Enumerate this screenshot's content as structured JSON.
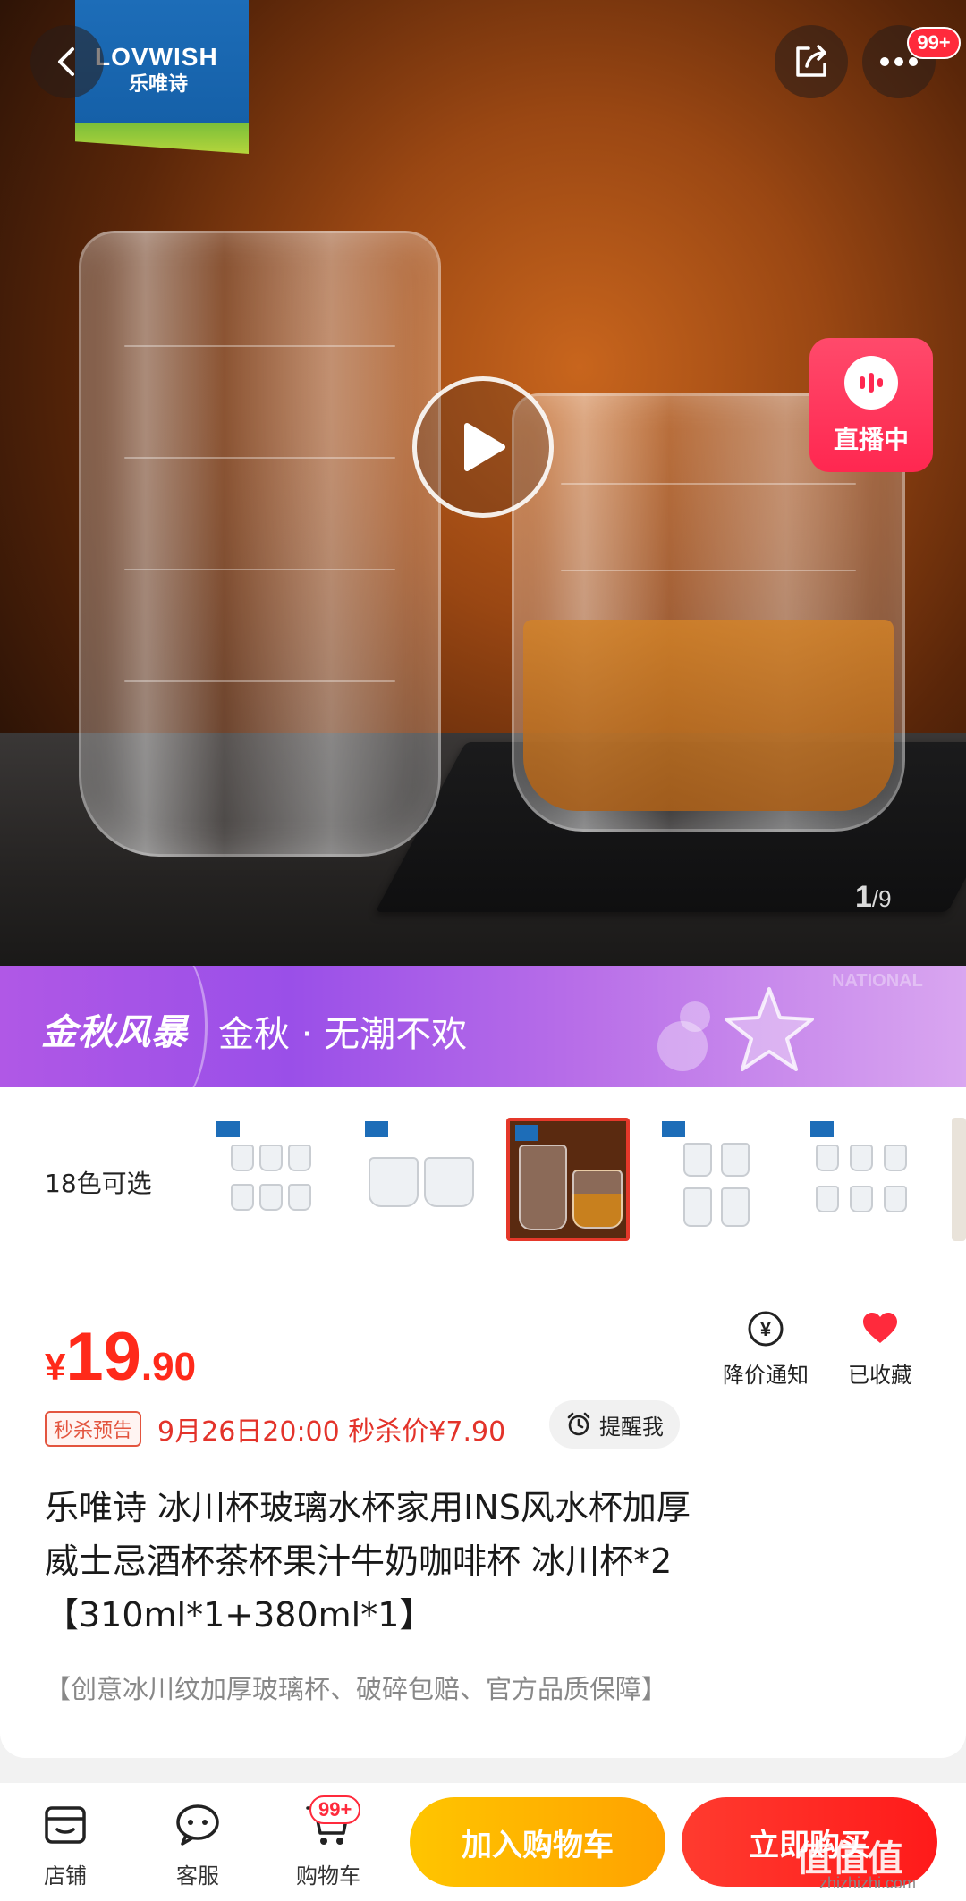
{
  "hero": {
    "brand_logo_text": "LOVWISH",
    "brand_logo_cn": "乐唯诗",
    "more_badge": "99+",
    "live_label": "直播中",
    "page_current": "1",
    "page_total": "/9",
    "icons": [
      "back-icon",
      "share-icon",
      "more-icon",
      "play-icon",
      "live-icon"
    ]
  },
  "promo": {
    "brand": "金秋风暴",
    "slogan": "金秋 · 无潮不欢",
    "deco": "NATIONAL"
  },
  "variants": {
    "count_label": "18色可选",
    "selected_index": 2
  },
  "price": {
    "currency": "¥",
    "integer": "19",
    "decimal": ".90"
  },
  "actions": {
    "price_alert": "降价通知",
    "favorited": "已收藏"
  },
  "flash_sale": {
    "tag": "秒杀预告",
    "text": "9月26日20:00 秒杀价¥7.90",
    "remind": "提醒我"
  },
  "product": {
    "title_line1": "乐唯诗 冰川杯玻璃水杯家用INS风水杯加厚",
    "title_line2": "威士忌酒杯茶杯果汁牛奶咖啡杯 冰川杯*2",
    "title_line3": "【310ml*1+380ml*1】",
    "subtitle": "【创意冰川纹加厚玻璃杯、破碎包赔、官方品质保障】"
  },
  "bottom_bar": {
    "shop": "店铺",
    "service": "客服",
    "cart": "购物车",
    "cart_badge": "99+",
    "add_to_cart": "加入购物车",
    "buy_now": "立即购买"
  },
  "watermark": {
    "text": "值值值",
    "sub": "zhizhizhi.com"
  },
  "colors": {
    "price_red": "#ff2a1a",
    "cart_yellow": "#ffb300",
    "buy_red": "#ff1a1a",
    "promo_purple": "#9a4fe8",
    "live_pink": "#ff2750"
  }
}
